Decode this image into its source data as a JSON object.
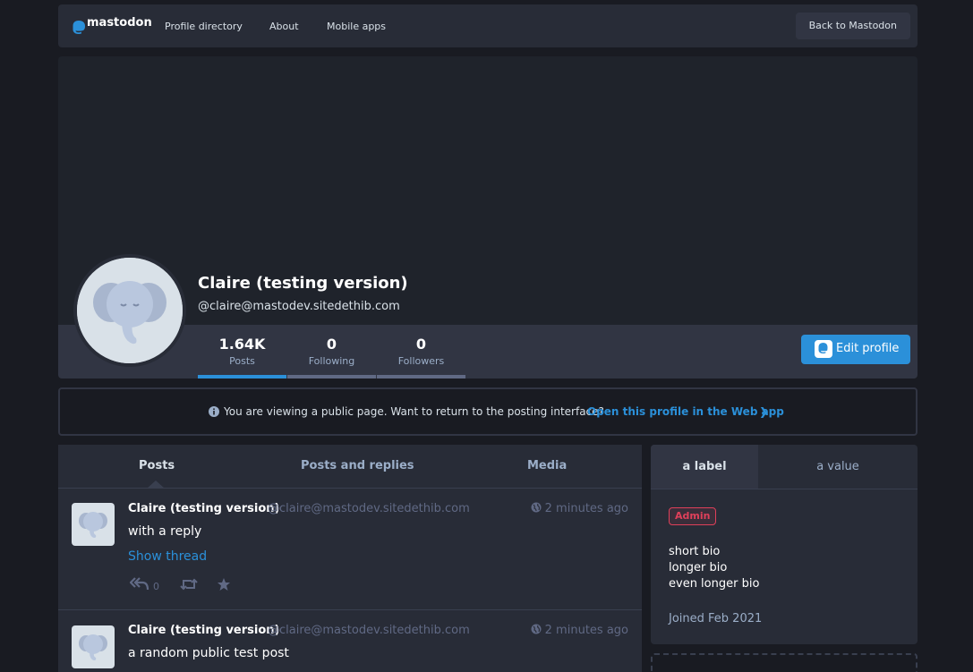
{
  "nav": {
    "logo_text": "mastodon",
    "links": [
      "Profile directory",
      "About",
      "Mobile apps"
    ],
    "back_label": "Back to Mastodon"
  },
  "profile": {
    "display_name": "Claire (testing version)",
    "acct": "@claire@mastodev.sitedethib.com",
    "counters": [
      {
        "num": "1.64K",
        "label": "Posts"
      },
      {
        "num": "0",
        "label": "Following"
      },
      {
        "num": "0",
        "label": "Followers"
      }
    ],
    "edit_label": "Edit profile"
  },
  "notice": {
    "text": "You are viewing a public page. Want to return to the posting interface?",
    "link": "Open this profile in the Web app"
  },
  "tabs": [
    "Posts",
    "Posts and replies",
    "Media"
  ],
  "statuses": [
    {
      "name": "Claire (testing version)",
      "handle": "@claire@mastodev.sitedethib.com",
      "time": "2 minutes ago",
      "content": "with a reply",
      "thread_link": "Show thread",
      "reply_count": "0"
    },
    {
      "name": "Claire (testing version)",
      "handle": "@claire@mastodev.sitedethib.com",
      "time": "2 minutes ago",
      "content": "a random public test post"
    }
  ],
  "sidebar": {
    "field_label": "a label",
    "field_value": "a value",
    "badge": "Admin",
    "bio": [
      "short bio",
      "longer bio",
      "even longer bio"
    ],
    "joined": "Joined Feb 2021"
  },
  "colors": {
    "accent": "#2b90d9",
    "background": "#191b22",
    "panel": "#282c37",
    "admin_badge": "#df405a"
  }
}
